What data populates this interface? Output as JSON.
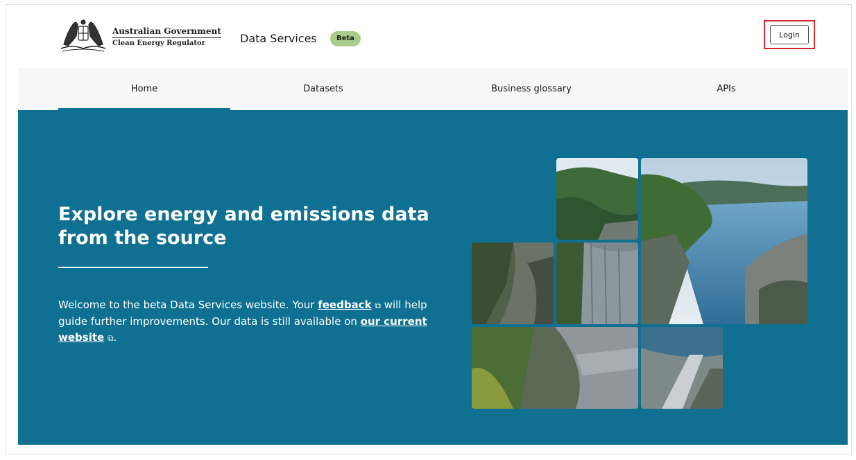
{
  "header": {
    "gov_name": "Australian Government",
    "agency_name": "Clean Energy Regulator",
    "site_name": "Data Services",
    "badge": "Beta",
    "login_label": "Login"
  },
  "nav": {
    "items": [
      {
        "label": "Home"
      },
      {
        "label": "Datasets"
      },
      {
        "label": "Business glossary"
      },
      {
        "label": "APIs"
      }
    ],
    "active": "Home"
  },
  "hero": {
    "title": "Explore energy and emissions data from the source",
    "text_part1": "Welcome to the beta Data Services website. Your ",
    "feedback_link": "feedback",
    "text_part2": " will help guide further improvements. Our data is still available on ",
    "current_site_link": "our current website",
    "text_end": ".",
    "ext_icon": "external-link-icon"
  },
  "colors": {
    "hero_bg": "#0f7092",
    "badge_bg": "#a8cc8a",
    "login_highlight": "#d4282c"
  }
}
